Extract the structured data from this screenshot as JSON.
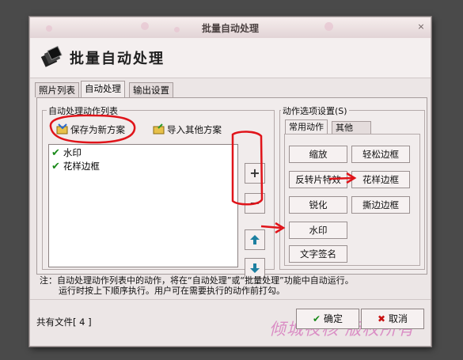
{
  "window": {
    "title": "批量自动处理",
    "heading": "批量自动处理",
    "close_glyph": "×"
  },
  "tabs": [
    "照片列表",
    "自动处理",
    "输出设置"
  ],
  "active_tab": "自动处理",
  "left_group": {
    "label": "自动处理动作列表",
    "save_label": "保存为新方案",
    "import_label": "导入其他方案",
    "items": [
      {
        "label": "水印",
        "checked": true
      },
      {
        "label": "花样边框",
        "checked": true
      }
    ]
  },
  "side_buttons": {
    "add": "+",
    "remove": "−",
    "up_icon": "arrow-up-icon",
    "down_icon": "arrow-down-icon"
  },
  "right_group": {
    "label": "动作选项设置(S)",
    "tabs": [
      "常用动作",
      "其他"
    ],
    "active_tab": "常用动作",
    "buttons": [
      "缩放",
      "轻松边框",
      "反转片特效",
      "花样边框",
      "锐化",
      "撕边边框",
      "水印",
      "文字签名"
    ]
  },
  "note": {
    "line1": "注：自动处理动作列表中的动作，将在“自动处理”或“批量处理”功能中自动运行。",
    "line2": "运行时按上下顺序执行。用户可在需要执行的动作前打勾。"
  },
  "footer": {
    "file_count": "共有文件[ 4 ]",
    "ok_label": "确定",
    "cancel_label": "取消"
  },
  "watermark": "倾城夜核 版权所有",
  "colors": {
    "annotation": "#e0141a",
    "accent_green": "#1a8a1a",
    "watermark": "#d77dbe"
  }
}
